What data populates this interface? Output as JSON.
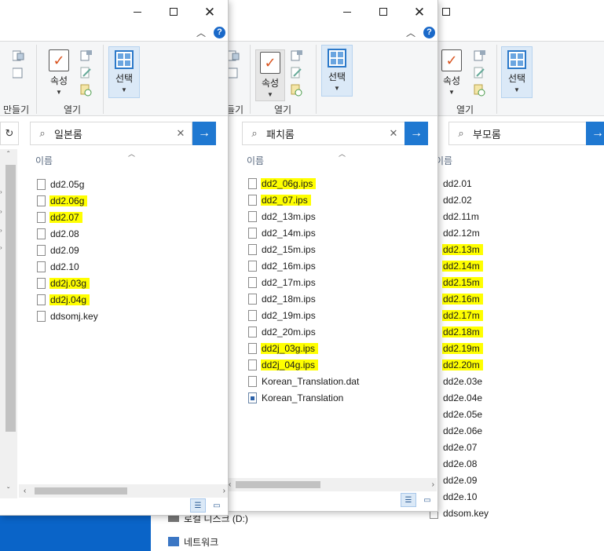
{
  "taskbar_nav": {
    "drive_label": "로컬 디스크 (D:)",
    "network_label": "네트워크"
  },
  "ribbon": {
    "properties_label": "속성",
    "open_group_label": "열기",
    "select_label": "선택",
    "new_group_partial_label": "만들기",
    "new_group_partial_label_short": "들기"
  },
  "columns": {
    "name": "이름"
  },
  "window_left": {
    "search_text": "일본롬",
    "files": [
      {
        "name": "dd2.05g",
        "highlighted": false,
        "icon": "file-icon"
      },
      {
        "name": "dd2.06g",
        "highlighted": true,
        "icon": "file-icon"
      },
      {
        "name": "dd2.07",
        "highlighted": true,
        "icon": "file-icon"
      },
      {
        "name": "dd2.08",
        "highlighted": false,
        "icon": "file-icon"
      },
      {
        "name": "dd2.09",
        "highlighted": false,
        "icon": "file-icon"
      },
      {
        "name": "dd2.10",
        "highlighted": false,
        "icon": "file-icon"
      },
      {
        "name": "dd2j.03g",
        "highlighted": true,
        "icon": "file-icon"
      },
      {
        "name": "dd2j.04g",
        "highlighted": true,
        "icon": "file-icon"
      },
      {
        "name": "ddsomj.key",
        "highlighted": false,
        "icon": "file-icon"
      }
    ]
  },
  "window_middle": {
    "search_text": "패치롬",
    "files": [
      {
        "name": "dd2_06g.ips",
        "highlighted": true,
        "icon": "file-icon"
      },
      {
        "name": "dd2_07.ips",
        "highlighted": true,
        "icon": "file-icon"
      },
      {
        "name": "dd2_13m.ips",
        "highlighted": false,
        "icon": "file-icon"
      },
      {
        "name": "dd2_14m.ips",
        "highlighted": false,
        "icon": "file-icon"
      },
      {
        "name": "dd2_15m.ips",
        "highlighted": false,
        "icon": "file-icon"
      },
      {
        "name": "dd2_16m.ips",
        "highlighted": false,
        "icon": "file-icon"
      },
      {
        "name": "dd2_17m.ips",
        "highlighted": false,
        "icon": "file-icon"
      },
      {
        "name": "dd2_18m.ips",
        "highlighted": false,
        "icon": "file-icon"
      },
      {
        "name": "dd2_19m.ips",
        "highlighted": false,
        "icon": "file-icon"
      },
      {
        "name": "dd2_20m.ips",
        "highlighted": false,
        "icon": "file-icon"
      },
      {
        "name": "dd2j_03g.ips",
        "highlighted": true,
        "icon": "file-icon"
      },
      {
        "name": "dd2j_04g.ips",
        "highlighted": true,
        "icon": "file-icon"
      },
      {
        "name": "Korean_Translation.dat",
        "highlighted": false,
        "icon": "file-icon"
      },
      {
        "name": "Korean_Translation",
        "highlighted": false,
        "icon": "image-file-icon"
      }
    ]
  },
  "window_right": {
    "search_text": "부모롬",
    "files": [
      {
        "name": "dd2.01",
        "highlighted": false
      },
      {
        "name": "dd2.02",
        "highlighted": false
      },
      {
        "name": "dd2.11m",
        "highlighted": false
      },
      {
        "name": "dd2.12m",
        "highlighted": false
      },
      {
        "name": "dd2.13m",
        "highlighted": true
      },
      {
        "name": "dd2.14m",
        "highlighted": true
      },
      {
        "name": "dd2.15m",
        "highlighted": true
      },
      {
        "name": "dd2.16m",
        "highlighted": true
      },
      {
        "name": "dd2.17m",
        "highlighted": true
      },
      {
        "name": "dd2.18m",
        "highlighted": true
      },
      {
        "name": "dd2.19m",
        "highlighted": true
      },
      {
        "name": "dd2.20m",
        "highlighted": true
      },
      {
        "name": "dd2e.03e",
        "highlighted": false
      },
      {
        "name": "dd2e.04e",
        "highlighted": false
      },
      {
        "name": "dd2e.05e",
        "highlighted": false
      },
      {
        "name": "dd2e.06e",
        "highlighted": false
      },
      {
        "name": "dd2e.07",
        "highlighted": false
      },
      {
        "name": "dd2e.08",
        "highlighted": false
      },
      {
        "name": "dd2e.09",
        "highlighted": false
      },
      {
        "name": "dd2e.10",
        "highlighted": false
      },
      {
        "name": "ddsom.key",
        "highlighted": false
      }
    ]
  },
  "colors": {
    "highlight": "#ffff00",
    "accent": "#1f78d1",
    "desktop": "#0a64c8"
  }
}
